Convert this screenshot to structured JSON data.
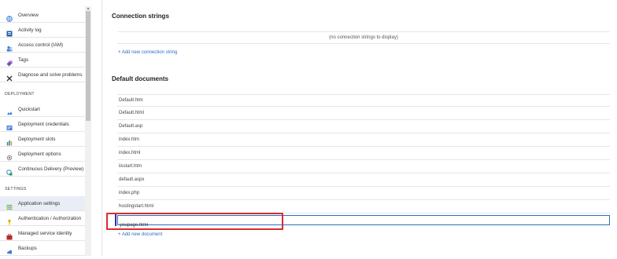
{
  "sidebar": {
    "items_top": [
      {
        "label": "Overview",
        "icon": "globe-icon"
      },
      {
        "label": "Activity log",
        "icon": "log-icon"
      },
      {
        "label": "Access control (IAM)",
        "icon": "users-icon"
      },
      {
        "label": "Tags",
        "icon": "tag-icon"
      },
      {
        "label": "Diagnose and solve problems",
        "icon": "wrench-icon"
      }
    ],
    "deployment_header": "DEPLOYMENT",
    "deployment_items": [
      {
        "label": "Quickstart",
        "icon": "cloud-icon"
      },
      {
        "label": "Deployment credentials",
        "icon": "credentials-icon"
      },
      {
        "label": "Deployment slots",
        "icon": "slots-icon"
      },
      {
        "label": "Deployment options",
        "icon": "gear-icon"
      },
      {
        "label": "Continuous Delivery (Preview)",
        "icon": "delivery-icon"
      }
    ],
    "settings_header": "SETTINGS",
    "settings_items": [
      {
        "label": "Application settings",
        "icon": "settings-list-icon",
        "active": true
      },
      {
        "label": "Authentication / Authorization",
        "icon": "key-icon"
      },
      {
        "label": "Managed service identity",
        "icon": "identity-icon"
      },
      {
        "label": "Backups",
        "icon": "backup-icon"
      }
    ],
    "scroll_up_glyph": "▲"
  },
  "connection_strings": {
    "title": "Connection strings",
    "empty_text": "(no connection strings to display)",
    "add_link": "+ Add new connection string"
  },
  "default_documents": {
    "title": "Default documents",
    "documents": [
      "Default.htm",
      "Default.html",
      "Default.asp",
      "index.htm",
      "index.html",
      "iisstart.htm",
      "default.aspx",
      "index.php",
      "hostingstart.html"
    ],
    "new_document_value": "youpage.html",
    "add_link": "+ Add new document"
  },
  "colors": {
    "accent": "#2a6dbf",
    "highlight": "#d92c2c",
    "active_bg": "#e9eef6"
  }
}
